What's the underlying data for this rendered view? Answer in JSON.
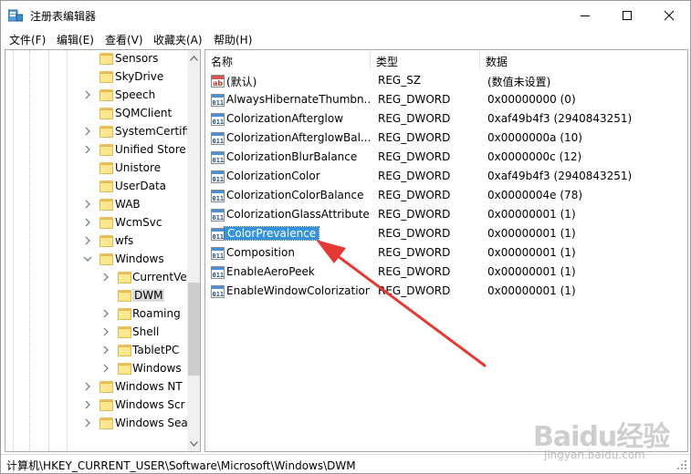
{
  "window": {
    "title": "注册表编辑器",
    "icons": {
      "app": "registry-editor-icon",
      "minimize": "minimize-icon",
      "maximize": "maximize-icon",
      "close": "close-icon"
    }
  },
  "menu": [
    "文件(F)",
    "编辑(E)",
    "查看(V)",
    "收藏夹(A)",
    "帮助(H)"
  ],
  "tree": {
    "items": [
      {
        "label": "Sensors",
        "depth": 1,
        "expander": "",
        "selected": false
      },
      {
        "label": "SkyDrive",
        "depth": 1,
        "expander": "",
        "selected": false
      },
      {
        "label": "Speech",
        "depth": 1,
        "expander": "collapsed",
        "selected": false
      },
      {
        "label": "SQMClient",
        "depth": 1,
        "expander": "",
        "selected": false
      },
      {
        "label": "SystemCertifi",
        "depth": 1,
        "expander": "collapsed",
        "selected": false
      },
      {
        "label": "Unified Store",
        "depth": 1,
        "expander": "collapsed",
        "selected": false
      },
      {
        "label": "Unistore",
        "depth": 1,
        "expander": "",
        "selected": false
      },
      {
        "label": "UserData",
        "depth": 1,
        "expander": "",
        "selected": false
      },
      {
        "label": "WAB",
        "depth": 1,
        "expander": "collapsed",
        "selected": false
      },
      {
        "label": "WcmSvc",
        "depth": 1,
        "expander": "collapsed",
        "selected": false
      },
      {
        "label": "wfs",
        "depth": 1,
        "expander": "collapsed",
        "selected": false
      },
      {
        "label": "Windows",
        "depth": 1,
        "expander": "expanded",
        "selected": false
      },
      {
        "label": "CurrentVe",
        "depth": 2,
        "expander": "collapsed",
        "selected": false
      },
      {
        "label": "DWM",
        "depth": 2,
        "expander": "",
        "selected": true
      },
      {
        "label": "Roaming",
        "depth": 2,
        "expander": "collapsed",
        "selected": false
      },
      {
        "label": "Shell",
        "depth": 2,
        "expander": "collapsed",
        "selected": false
      },
      {
        "label": "TabletPC",
        "depth": 2,
        "expander": "collapsed",
        "selected": false
      },
      {
        "label": "Windows",
        "depth": 2,
        "expander": "collapsed",
        "selected": false
      },
      {
        "label": "Windows NT",
        "depth": 1,
        "expander": "collapsed",
        "selected": false
      },
      {
        "label": "Windows Scr",
        "depth": 1,
        "expander": "collapsed",
        "selected": false
      },
      {
        "label": "Windows Sea",
        "depth": 1,
        "expander": "collapsed",
        "selected": false
      }
    ]
  },
  "list": {
    "headers": {
      "name": "名称",
      "type": "类型",
      "data": "数据"
    },
    "rows": [
      {
        "icon": "string-value-icon",
        "name": "(默认)",
        "type": "REG_SZ",
        "data": "(数值未设置)",
        "selected": false
      },
      {
        "icon": "binary-value-icon",
        "name": "AlwaysHibernateThumbn...",
        "type": "REG_DWORD",
        "data": "0x00000000 (0)",
        "selected": false
      },
      {
        "icon": "binary-value-icon",
        "name": "ColorizationAfterglow",
        "type": "REG_DWORD",
        "data": "0xaf49b4f3 (2940843251)",
        "selected": false
      },
      {
        "icon": "binary-value-icon",
        "name": "ColorizationAfterglowBal...",
        "type": "REG_DWORD",
        "data": "0x0000000a (10)",
        "selected": false
      },
      {
        "icon": "binary-value-icon",
        "name": "ColorizationBlurBalance",
        "type": "REG_DWORD",
        "data": "0x0000000c (12)",
        "selected": false
      },
      {
        "icon": "binary-value-icon",
        "name": "ColorizationColor",
        "type": "REG_DWORD",
        "data": "0xaf49b4f3 (2940843251)",
        "selected": false
      },
      {
        "icon": "binary-value-icon",
        "name": "ColorizationColorBalance",
        "type": "REG_DWORD",
        "data": "0x0000004e (78)",
        "selected": false
      },
      {
        "icon": "binary-value-icon",
        "name": "ColorizationGlassAttribute",
        "type": "REG_DWORD",
        "data": "0x00000001 (1)",
        "selected": false
      },
      {
        "icon": "binary-value-icon",
        "name": "ColorPrevalence",
        "type": "REG_DWORD",
        "data": "0x00000001 (1)",
        "selected": true
      },
      {
        "icon": "binary-value-icon",
        "name": "Composition",
        "type": "REG_DWORD",
        "data": "0x00000001 (1)",
        "selected": false
      },
      {
        "icon": "binary-value-icon",
        "name": "EnableAeroPeek",
        "type": "REG_DWORD",
        "data": "0x00000001 (1)",
        "selected": false
      },
      {
        "icon": "binary-value-icon",
        "name": "EnableWindowColorization",
        "type": "REG_DWORD",
        "data": "0x00000001 (1)",
        "selected": false
      }
    ]
  },
  "statusbar": {
    "path": "计算机\\HKEY_CURRENT_USER\\Software\\Microsoft\\Windows\\DWM"
  },
  "annotation": {
    "color": "#e53935"
  },
  "watermark": {
    "main": "Baidu经验",
    "sub": "jingyan.baidu.com"
  },
  "colors": {
    "selection": "#3393df",
    "folder": "#fde890"
  }
}
